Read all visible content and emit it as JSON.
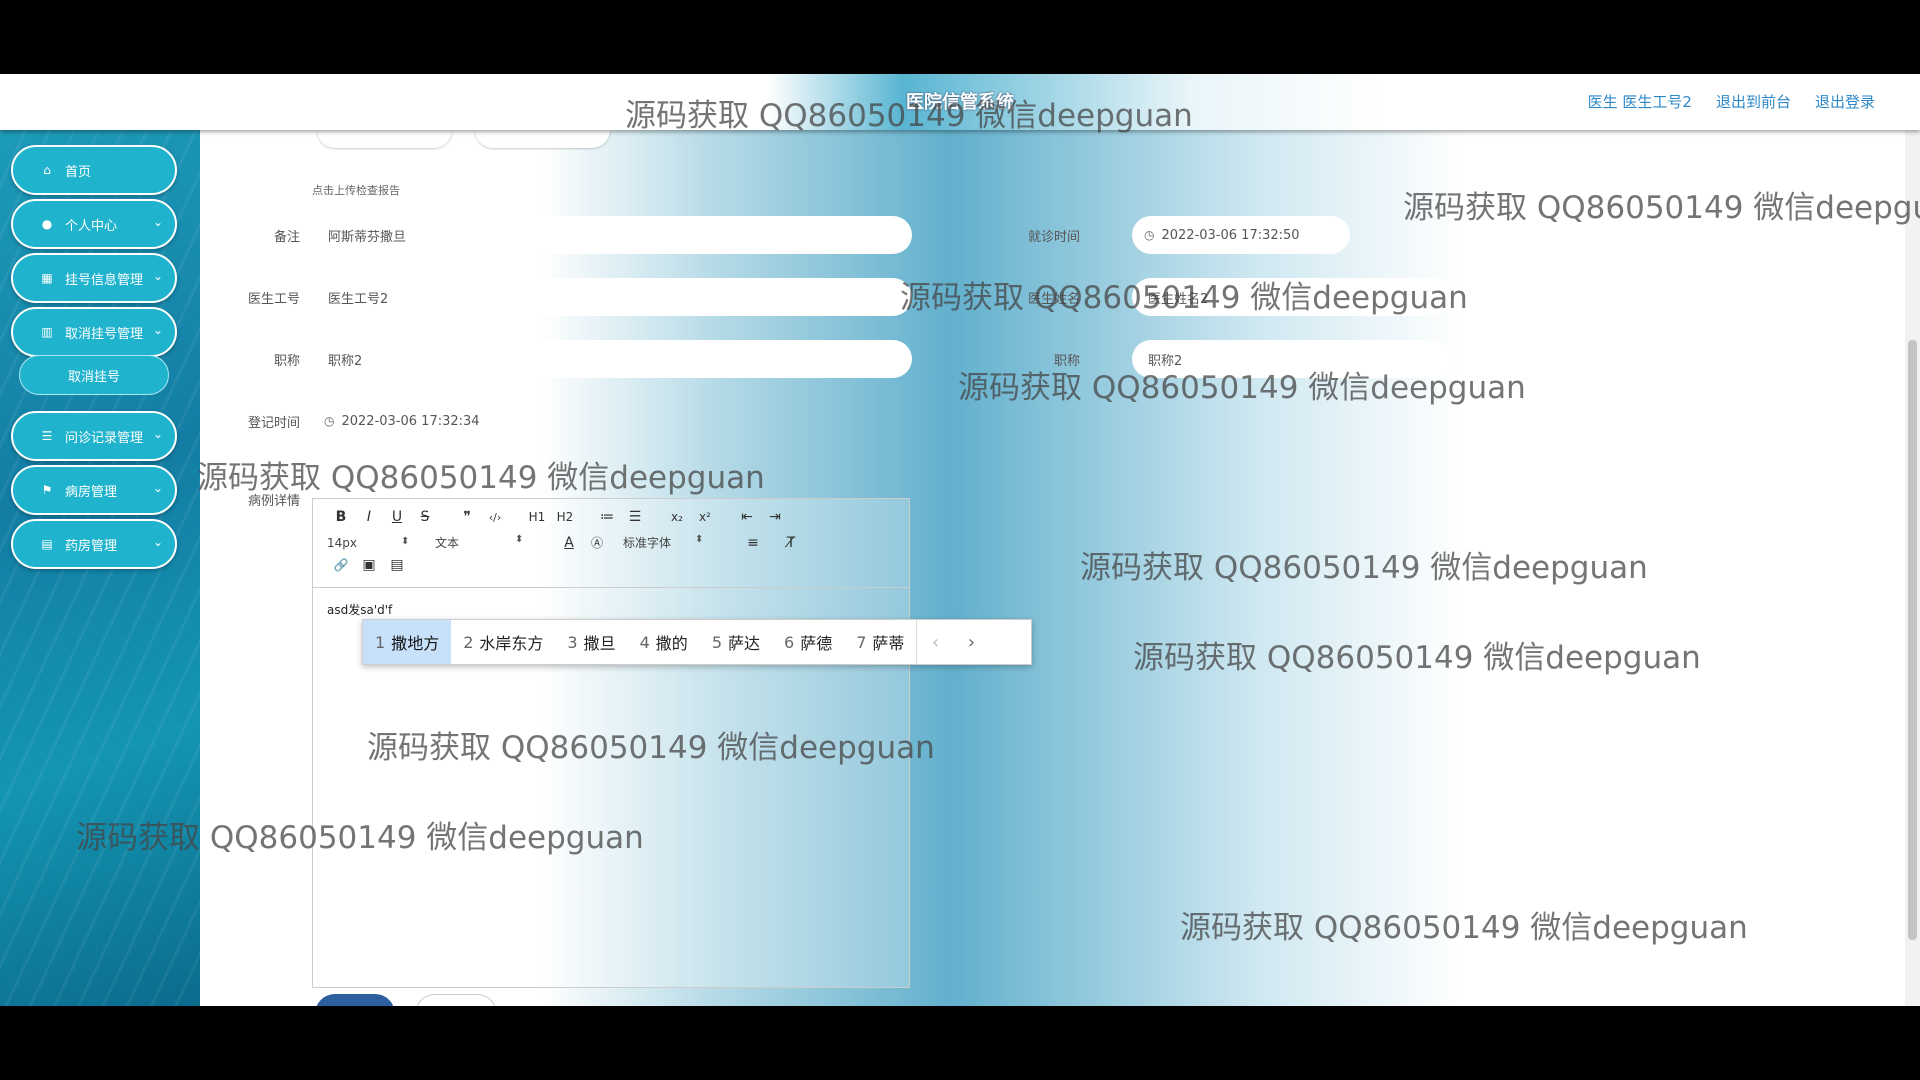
{
  "header": {
    "title": "医院信管系统",
    "links": [
      "医生 医生工号2",
      "退出到前台",
      "退出登录"
    ]
  },
  "sidebar": {
    "items": [
      {
        "label": "首页",
        "icon": "home-icon",
        "glyph": "⌂",
        "chevron": false
      },
      {
        "label": "个人中心",
        "icon": "user-icon",
        "glyph": "●",
        "chevron": true
      },
      {
        "label": "挂号信息管理",
        "icon": "grid-icon",
        "glyph": "▦",
        "chevron": true
      },
      {
        "label": "取消挂号管理",
        "icon": "chart-icon",
        "glyph": "▥",
        "chevron": true
      },
      {
        "label": "问诊记录管理",
        "icon": "list-icon",
        "glyph": "☰",
        "chevron": true
      },
      {
        "label": "病房管理",
        "icon": "flag-icon",
        "glyph": "⚑",
        "chevron": true
      },
      {
        "label": "药房管理",
        "icon": "clipboard-icon",
        "glyph": "▤",
        "chevron": true
      }
    ],
    "submenu": {
      "label": "取消挂号"
    }
  },
  "form": {
    "upload_hint": "点击上传检查报告",
    "remark": {
      "label": "备注",
      "value": "阿斯蒂芬撒旦"
    },
    "visit_time": {
      "label": "就诊时间",
      "value": "2022-03-06 17:32:50"
    },
    "doctor_id": {
      "label": "医生工号",
      "value": "医生工号2"
    },
    "doctor_name": {
      "label": "医生姓名",
      "value": "医生姓名2"
    },
    "title_field": {
      "label": "职称",
      "value": "职称2"
    },
    "title_field_2": {
      "label": "职称",
      "value": "职称2"
    },
    "register_time": {
      "label": "登记时间",
      "value": "2022-03-06 17:32:34"
    },
    "case_detail": {
      "label": "病例详情"
    }
  },
  "editor": {
    "font_size": "14px",
    "block_format": "文本",
    "font_family": "标准字体",
    "content": "asd发sa'd'f",
    "toolbar_row1": [
      {
        "name": "bold-icon",
        "glyph": "B"
      },
      {
        "name": "italic-icon",
        "glyph": "I"
      },
      {
        "name": "underline-icon",
        "glyph": "U"
      },
      {
        "name": "strikethrough-icon",
        "glyph": "S"
      },
      {
        "name": "quote-icon",
        "glyph": "❞"
      },
      {
        "name": "code-icon",
        "glyph": "‹/›"
      },
      {
        "name": "heading1-icon",
        "glyph": "H1"
      },
      {
        "name": "heading2-icon",
        "glyph": "H2"
      },
      {
        "name": "ordered-list-icon",
        "glyph": "≔"
      },
      {
        "name": "bullet-list-icon",
        "glyph": "☰"
      },
      {
        "name": "subscript-icon",
        "glyph": "x₂"
      },
      {
        "name": "superscript-icon",
        "glyph": "x²"
      },
      {
        "name": "outdent-icon",
        "glyph": "⇤"
      },
      {
        "name": "indent-icon",
        "glyph": "⇥"
      }
    ],
    "toolbar_row2_icons": [
      {
        "name": "font-color-icon",
        "glyph": "A"
      },
      {
        "name": "background-color-icon",
        "glyph": "Ⓐ"
      },
      {
        "name": "align-icon",
        "glyph": "≡"
      },
      {
        "name": "clear-format-icon",
        "glyph": "T̸"
      }
    ],
    "toolbar_row3": [
      {
        "name": "link-icon",
        "glyph": "🔗"
      },
      {
        "name": "image-icon",
        "glyph": "▣"
      },
      {
        "name": "video-icon",
        "glyph": "▤"
      }
    ]
  },
  "ime": {
    "candidates": [
      {
        "num": "1",
        "text": "撒地方"
      },
      {
        "num": "2",
        "text": "水岸东方"
      },
      {
        "num": "3",
        "text": "撒旦"
      },
      {
        "num": "4",
        "text": "撒的"
      },
      {
        "num": "5",
        "text": "萨达"
      },
      {
        "num": "6",
        "text": "萨德"
      },
      {
        "num": "7",
        "text": "萨蒂"
      }
    ],
    "prev_glyph": "‹",
    "next_glyph": "›"
  },
  "watermark": "源码获取 QQ86050149 微信deepguan",
  "colors": {
    "accent": "#20b3cd",
    "link": "#2e88c8"
  }
}
